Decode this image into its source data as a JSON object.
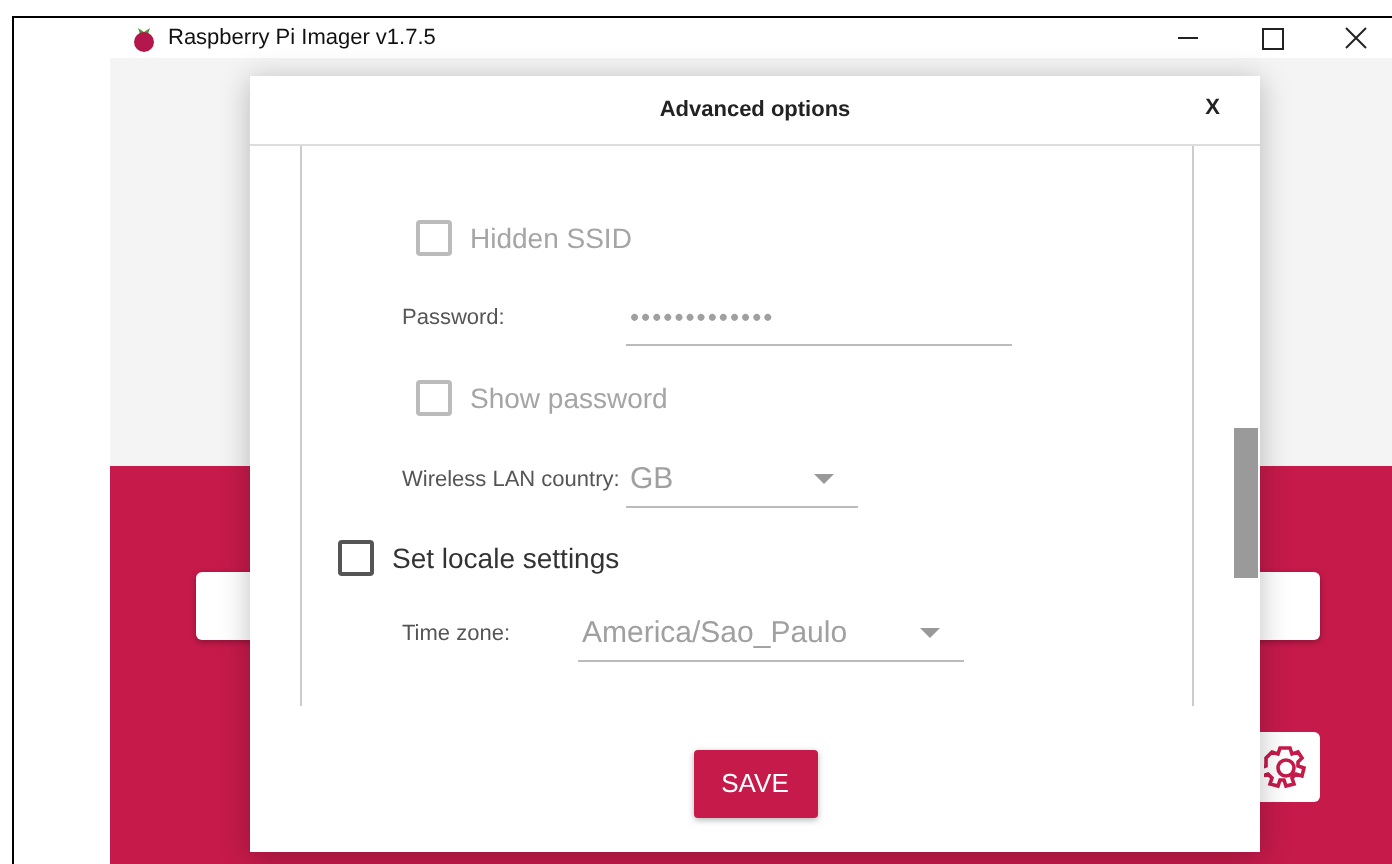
{
  "window": {
    "title": "Raspberry Pi Imager v1.7.5"
  },
  "dialog": {
    "title": "Advanced options",
    "close": "X",
    "items": [
      {
        "kind": "group",
        "children": [
          {
            "kind": "checkbox",
            "label": "Hidden SSID",
            "checked": false,
            "disabled": true
          },
          {
            "kind": "password",
            "label": "Password:",
            "value": "•••••••••••••",
            "disabled": true
          },
          {
            "kind": "checkbox",
            "label": "Show password",
            "checked": false,
            "disabled": true
          },
          {
            "kind": "select",
            "label": "Wireless LAN country:",
            "value": "GB",
            "disabled": true
          }
        ]
      },
      {
        "kind": "checkbox",
        "label": "Set locale settings",
        "checked": false,
        "disabled": false,
        "children": [
          {
            "kind": "select",
            "label": "Time zone:",
            "value": "America/Sao_Paulo",
            "disabled": true
          }
        ]
      }
    ],
    "button": "SAVE"
  }
}
